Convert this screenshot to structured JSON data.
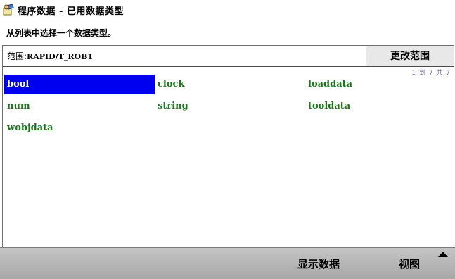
{
  "window": {
    "icon": "program-data-icon",
    "title": "程序数据 - 已用数据类型"
  },
  "instruction": "从列表中选择一个数据类型。",
  "scope": {
    "label": "范围:",
    "value": "RAPID/T_ROB1",
    "change_button": "更改范围"
  },
  "list": {
    "counter": "1 到 7 共 7",
    "selected": "bool",
    "items": [
      "bool",
      "clock",
      "loaddata",
      "num",
      "string",
      "tooldata",
      "wobjdata"
    ]
  },
  "toolbar": {
    "show_data": "显示数据",
    "view": "视图",
    "view_icon": "caret-up-icon"
  },
  "colors": {
    "selection": "#0000f0",
    "item_text": "#1a7a1a",
    "counter_text": "#7a6aa8",
    "toolbar": "#b4b4b4"
  }
}
